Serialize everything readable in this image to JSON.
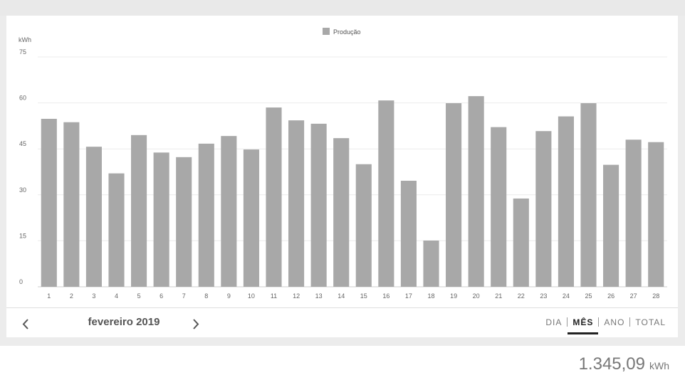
{
  "chart_data": {
    "type": "bar",
    "legend": [
      "Produção"
    ],
    "legend_position": "top-center",
    "ylabel": "kWh",
    "ylim": [
      0,
      75
    ],
    "yticks": [
      0,
      15,
      30,
      45,
      60,
      75
    ],
    "grid": true,
    "categories": [
      "1",
      "2",
      "3",
      "4",
      "5",
      "6",
      "7",
      "8",
      "9",
      "10",
      "11",
      "12",
      "13",
      "14",
      "15",
      "16",
      "17",
      "18",
      "19",
      "20",
      "21",
      "22",
      "23",
      "24",
      "25",
      "26",
      "27",
      "28"
    ],
    "series": [
      {
        "name": "Produção",
        "color": "#a8a8a8",
        "values": [
          54.8,
          53.7,
          45.7,
          37.0,
          49.5,
          43.8,
          42.3,
          46.7,
          49.2,
          44.8,
          58.5,
          54.3,
          53.2,
          48.5,
          40.0,
          60.8,
          34.6,
          15.1,
          59.9,
          62.2,
          52.1,
          28.8,
          50.8,
          55.6,
          59.9,
          39.8,
          48.0,
          47.2
        ]
      }
    ]
  },
  "navigation": {
    "period_label": "fevereiro 2019",
    "prev_icon": "chevron-left-icon",
    "next_icon": "chevron-right-icon"
  },
  "tabs": [
    {
      "label": "DIA",
      "active": false
    },
    {
      "label": "MÊS",
      "active": true
    },
    {
      "label": "ANO",
      "active": false
    },
    {
      "label": "TOTAL",
      "active": false
    }
  ],
  "total": {
    "value": "1.345,09",
    "unit": "kWh"
  }
}
